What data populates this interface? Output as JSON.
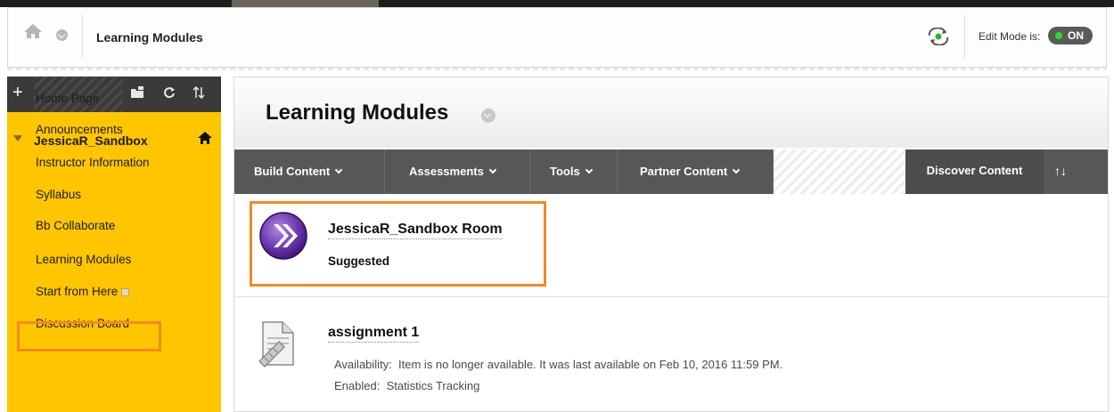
{
  "breadcrumb": {
    "title": "Learning Modules"
  },
  "edit_mode": {
    "label": "Edit Mode is:",
    "state": "ON"
  },
  "sidebar": {
    "course_title": "JessicaR_Sandbox",
    "items": [
      {
        "label": "Home Page"
      },
      {
        "label": "Announcements"
      },
      {
        "label": "Instructor Information"
      },
      {
        "label": "Syllabus"
      },
      {
        "label": "Bb Collaborate"
      },
      {
        "label": "Learning Modules"
      },
      {
        "label": "Start from Here"
      },
      {
        "label": "Discussion Board"
      }
    ]
  },
  "page": {
    "title": "Learning Modules"
  },
  "action_bar": {
    "build_content": "Build Content",
    "assessments": "Assessments",
    "tools": "Tools",
    "partner_content": "Partner Content",
    "discover_content": "Discover Content",
    "sort_icon": "↑↓"
  },
  "content_items": [
    {
      "title": "JessicaR_Sandbox Room",
      "subtitle": "Suggested"
    },
    {
      "title": "assignment 1",
      "availability_label": "Availability:",
      "availability_text": "Item is no longer available. It was last available on Feb 10, 2016 11:59 PM.",
      "enabled_label": "Enabled:",
      "enabled_text": "Statistics Tracking"
    }
  ],
  "colors": {
    "accent": "#ffc600",
    "highlight": "#f28a24",
    "action_bar": "#575757"
  }
}
